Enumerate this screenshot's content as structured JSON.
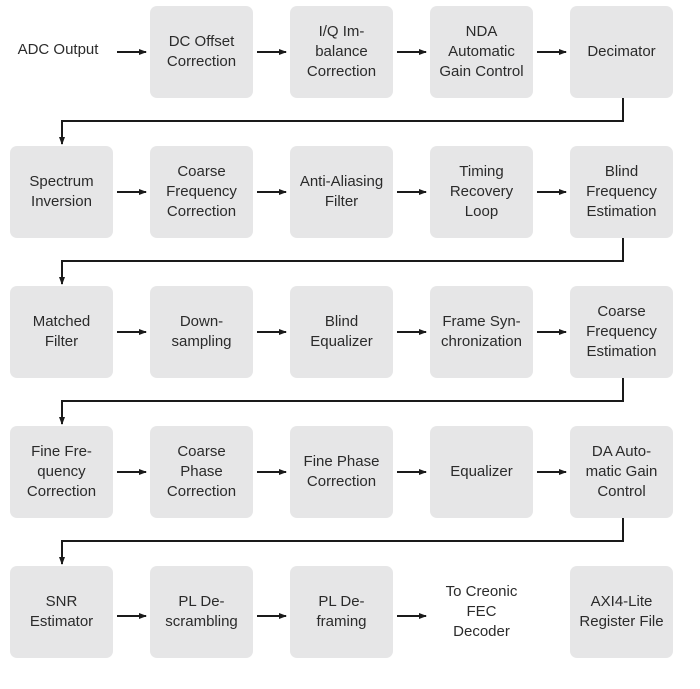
{
  "diagram": {
    "title": "",
    "input_label": "ADC Output",
    "rows": [
      [
        "DC Offset\nCorrection",
        "I/Q Im-\nbalance\nCorrection",
        "NDA\nAutomatic\nGain Control",
        "Decimator"
      ],
      [
        "Spectrum\nInversion",
        "Coarse\nFrequency\nCorrection",
        "Anti-Aliasing\nFilter",
        "Timing\nRecovery\nLoop",
        "Blind\nFrequency\nEstimation"
      ],
      [
        "Matched\nFilter",
        "Down-\nsampling",
        "Blind\nEqualizer",
        "Frame Syn-\nchronization",
        "Coarse\nFrequency\nEstimation"
      ],
      [
        "Fine Fre-\nquency\nCorrection",
        "Coarse\nPhase\nCorrection",
        "Fine Phase\nCorrection",
        "Equalizer",
        "DA Auto-\nmatic Gain\nControl"
      ],
      [
        "SNR\nEstimator",
        "PL De-\nscrambling",
        "PL De-\nframing",
        "To Creonic\nFEC\nDecoder"
      ]
    ],
    "standalone": "AXI4-Lite\nRegister File",
    "output_node_unboxed": "To Creonic\nFEC\nDecoder",
    "colors": {
      "box_fill": "#e6e6e7",
      "line": "#1a1a1a",
      "text": "#2b2b2b"
    }
  }
}
